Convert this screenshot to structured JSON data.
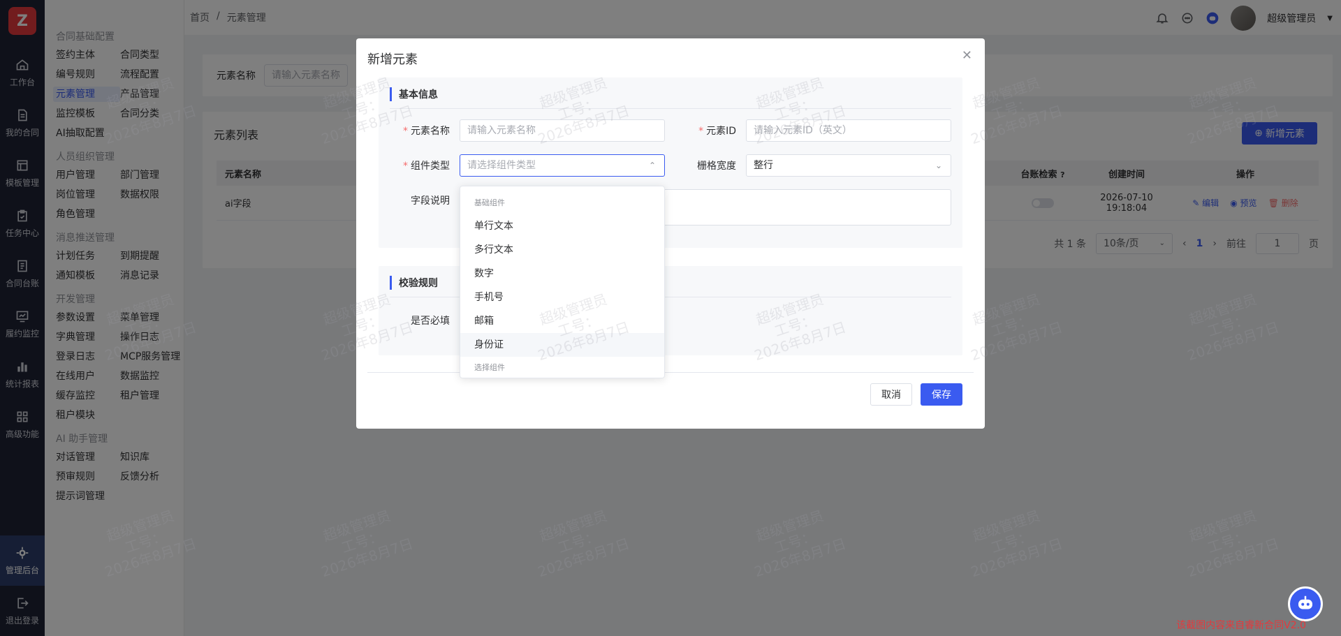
{
  "rail": {
    "logo_text": "Z",
    "items": [
      {
        "label": "工作台",
        "icon": "home-icon"
      },
      {
        "label": "我的合同",
        "icon": "document-icon"
      },
      {
        "label": "模板管理",
        "icon": "template-icon"
      },
      {
        "label": "任务中心",
        "icon": "clipboard-icon"
      },
      {
        "label": "合同台账",
        "icon": "ledger-icon"
      },
      {
        "label": "履约监控",
        "icon": "monitor-chart-icon"
      },
      {
        "label": "统计报表",
        "icon": "bar-chart-icon"
      },
      {
        "label": "高级功能",
        "icon": "grid-apps-icon"
      }
    ],
    "admin": {
      "label": "管理后台",
      "icon": "gear-icon"
    },
    "logout": {
      "label": "退出登录",
      "icon": "logout-icon"
    }
  },
  "submenu": {
    "groups": [
      {
        "title": "合同基础配置",
        "items": [
          "签约主体",
          "合同类型",
          "编号规则",
          "流程配置",
          "元素管理",
          "产品管理",
          "监控模板",
          "合同分类",
          "AI抽取配置"
        ]
      },
      {
        "title": "人员组织管理",
        "items": [
          "用户管理",
          "部门管理",
          "岗位管理",
          "数据权限",
          "角色管理"
        ]
      },
      {
        "title": "消息推送管理",
        "items": [
          "计划任务",
          "到期提醒",
          "通知模板",
          "消息记录"
        ]
      },
      {
        "title": "开发管理",
        "items": [
          "参数设置",
          "菜单管理",
          "字典管理",
          "操作日志",
          "登录日志",
          "MCP服务管理",
          "在线用户",
          "数据监控",
          "缓存监控",
          "租户管理",
          "租户模块"
        ]
      },
      {
        "title": "AI 助手管理",
        "items": [
          "对话管理",
          "知识库",
          "预审规则",
          "反馈分析",
          "提示词管理"
        ]
      }
    ],
    "active": "元素管理"
  },
  "topbar": {
    "breadcrumb": [
      "首页",
      "/",
      "元素管理"
    ],
    "user_name": "超级管理员"
  },
  "search": {
    "label": "元素名称",
    "placeholder": "请输入元素名称"
  },
  "list": {
    "title": "元素列表",
    "add_button": "新增元素",
    "columns": {
      "name": "元素名称",
      "ledger": "台账检索",
      "created": "创建时间",
      "ops": "操作"
    },
    "rows": [
      {
        "name": "ai字段",
        "created": "2026-07-10 19:18:04"
      }
    ],
    "ops": {
      "edit": "编辑",
      "preview": "预览",
      "delete": "删除"
    },
    "pager": {
      "total": "共 1 条",
      "page_size": "10条/页",
      "current": "1",
      "goto_label": "前往",
      "goto_value": "1",
      "page_unit": "页"
    }
  },
  "dialog": {
    "title": "新增元素",
    "section_basic": "基本信息",
    "section_rules": "校验规则",
    "fields": {
      "name_label": "元素名称",
      "name_placeholder": "请输入元素名称",
      "id_label": "元素ID",
      "id_placeholder": "请输入元素ID（英文）",
      "type_label": "组件类型",
      "type_placeholder": "请选择组件类型",
      "width_label": "栅格宽度",
      "width_value": "整行",
      "desc_label": "字段说明",
      "required_label": "是否必填"
    },
    "cancel": "取消",
    "save": "保存"
  },
  "dropdown": {
    "group1": "基础组件",
    "items": [
      "单行文本",
      "多行文本",
      "数字",
      "手机号",
      "邮箱",
      "身份证"
    ],
    "hovered": "身份证",
    "group2": "选择组件"
  },
  "watermark": {
    "line1": "超级管理员",
    "line2": "工号：",
    "line3": "2026年8月7日"
  },
  "footer_note": "该截图内容来自睿新合同V2.0",
  "colors": {
    "accent": "#3a5bf0",
    "rail_bg": "#1e2235",
    "danger": "#f56c6c"
  }
}
